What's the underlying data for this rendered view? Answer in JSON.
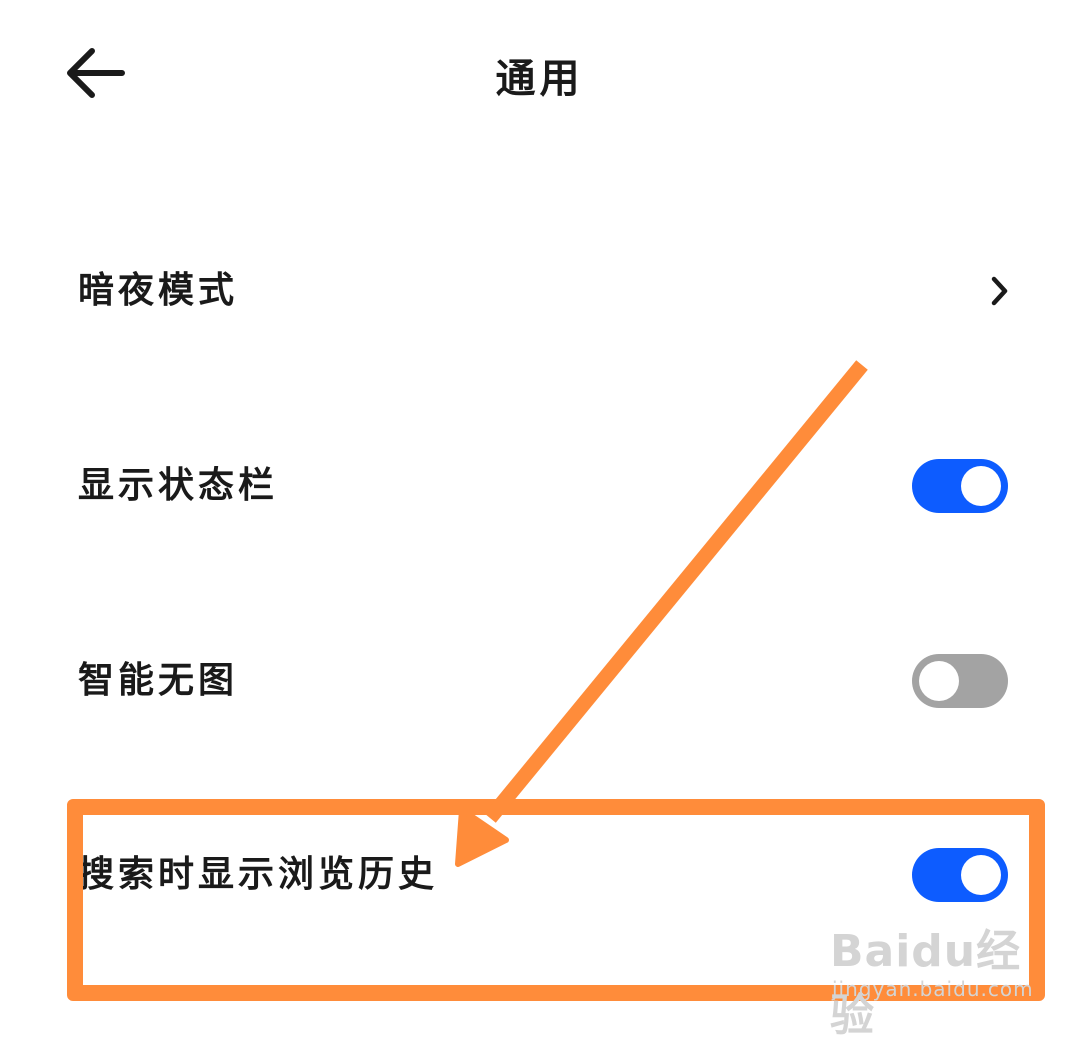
{
  "header": {
    "title": "通用",
    "back_icon": "arrow-left-icon"
  },
  "settings": [
    {
      "label": "暗夜模式",
      "control": "chevron",
      "icon": "chevron-right-icon"
    },
    {
      "label": "显示状态栏",
      "control": "toggle",
      "on": true
    },
    {
      "label": "智能无图",
      "control": "toggle",
      "on": false
    },
    {
      "label": "搜索时显示浏览历史",
      "control": "toggle",
      "on": true
    }
  ],
  "annotation": {
    "color": "#ff8c3a",
    "highlighted_item": "搜索时显示浏览历史"
  },
  "watermark": {
    "main": "Baidu经验",
    "sub": "jingyan.baidu.com"
  },
  "colors": {
    "toggle_on": "#0d5cff",
    "toggle_off": "#a3a3a3",
    "text": "#1a1a1a"
  }
}
